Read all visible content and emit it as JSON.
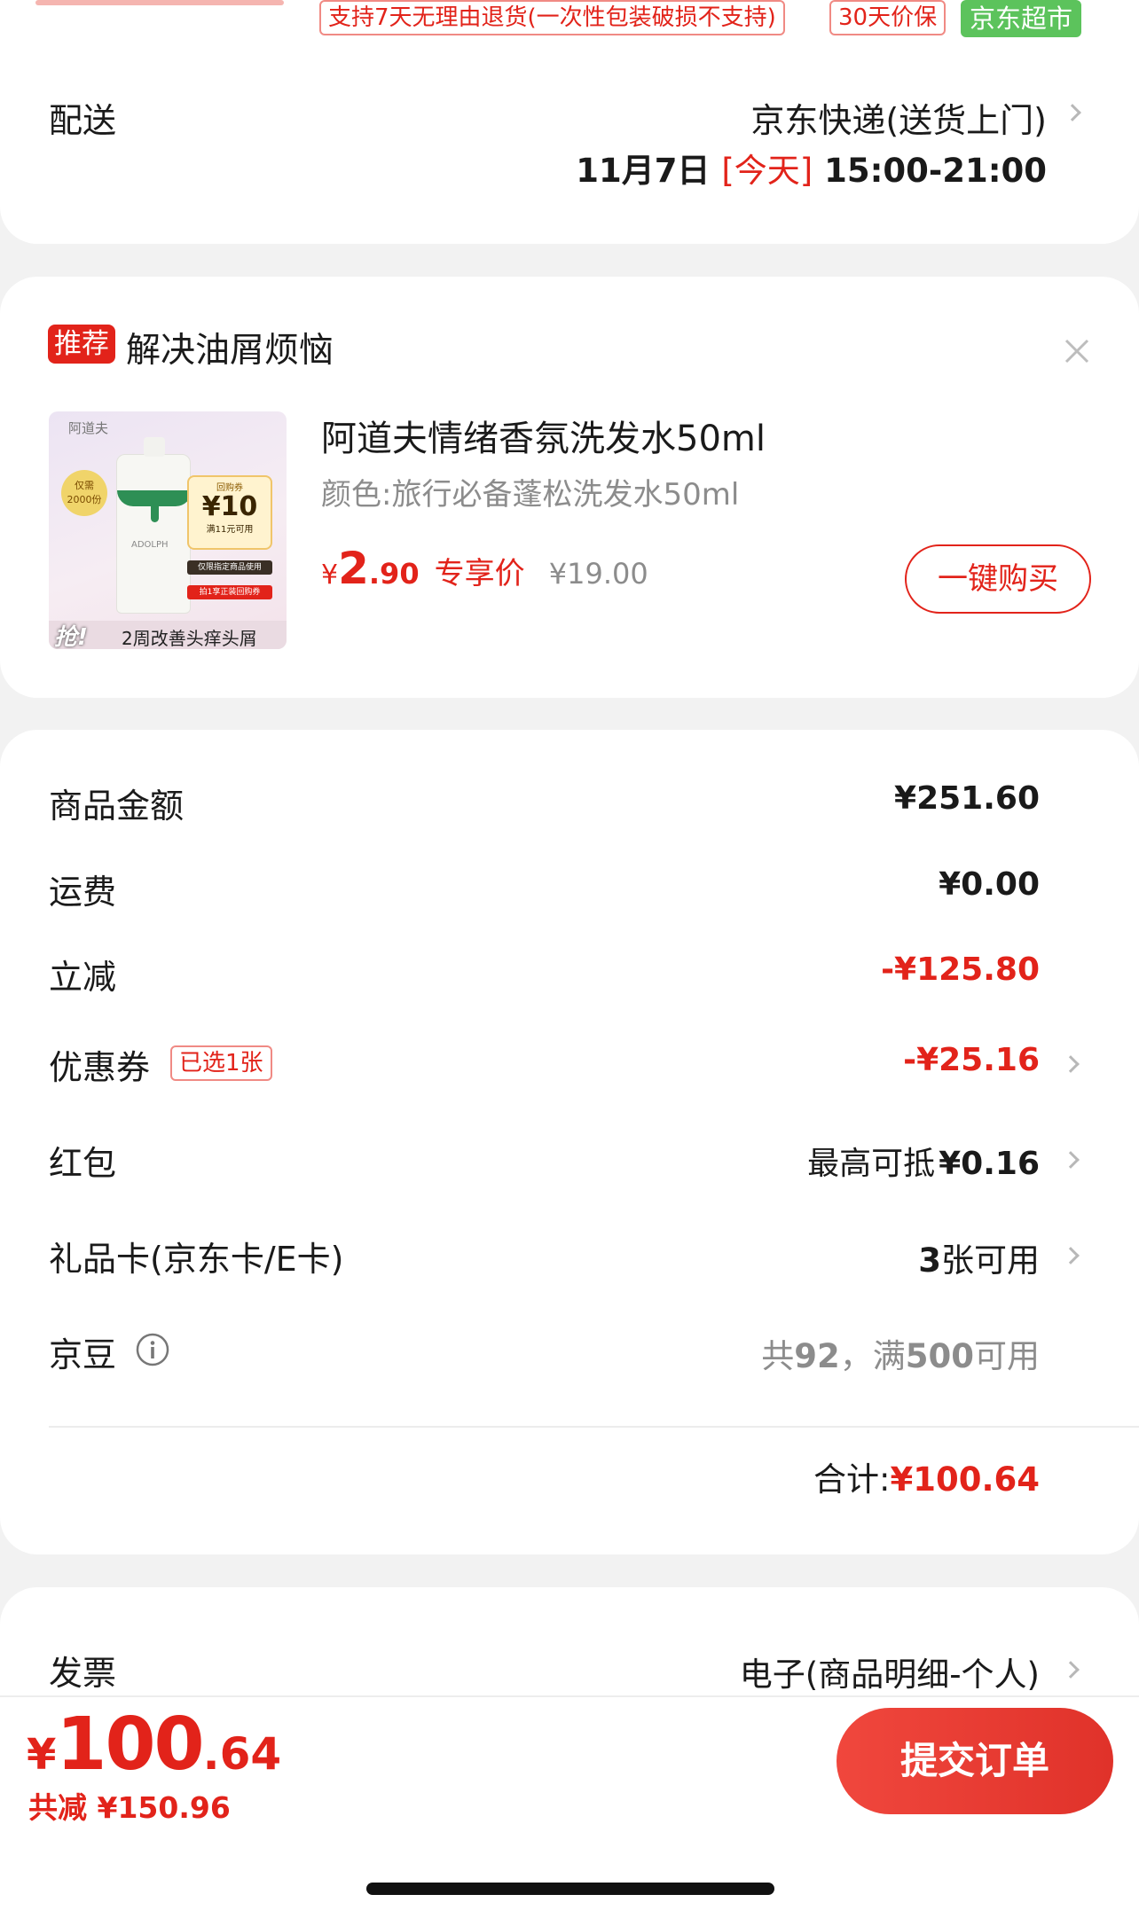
{
  "top_tags": {
    "return_policy": "支持7天无理由退货(一次性包装破损不支持)",
    "price_protect": "30天价保",
    "jd_supermarket": "京东超市"
  },
  "delivery": {
    "label": "配送",
    "method": "京东快递(送货上门)",
    "date": "11月7日",
    "today": "[今天]",
    "time": "15:00-21:00"
  },
  "recommend": {
    "badge": "推荐",
    "title": "解决油屑烦恼",
    "product_name": "阿道夫情绪香氛洗发水50ml",
    "variant": "颜色:旅行必备蓬松洗发水50ml",
    "price_symbol": "¥",
    "price_int": "2",
    "price_dec": ".90",
    "price_tag": "专享价",
    "original_price": "¥19.00",
    "buy_button": "一键购买",
    "image": {
      "brand": "阿道夫",
      "count_badge_line1": "仅需",
      "count_badge_line2": "2000份",
      "bottle_brand": "ADOLPH",
      "coupon_title": "回购券",
      "coupon_amount": "¥10",
      "coupon_condition": "满11元可用",
      "coupon_note1": "仅限指定商品使用",
      "coupon_note2": "拍1享正装回购券",
      "grab": "抢!",
      "slogan": "2周改善头痒头屑"
    }
  },
  "summary": {
    "rows": [
      {
        "label": "商品金额",
        "value": "¥251.60"
      },
      {
        "label": "运费",
        "value": "¥0.00"
      },
      {
        "label": "立减",
        "value": "-¥125.80"
      },
      {
        "label": "优惠券",
        "badge": "已选1张",
        "value": "-¥25.16"
      },
      {
        "label": "红包",
        "prefix": "最高可抵",
        "value": "¥0.16"
      },
      {
        "label": "礼品卡(京东卡/E卡)",
        "value_prefix": "3",
        "value": "张可用"
      },
      {
        "label": "京豆",
        "beans_a": "共",
        "beans_b": "92",
        "beans_c": "，满",
        "beans_d": "500",
        "beans_e": "可用"
      }
    ],
    "total_label": "合计:",
    "total_value": "¥100.64"
  },
  "invoice": {
    "label": "发票",
    "value": "电子(商品明细-个人)"
  },
  "bottom_bar": {
    "price_symbol": "¥",
    "price_int": "100",
    "price_dec": ".64",
    "savings": "共减 ¥150.96",
    "submit": "提交订单"
  },
  "colors": {
    "accent": "#e2231a",
    "green_tag": "#5cc35c",
    "background": "#f2f2f2"
  }
}
